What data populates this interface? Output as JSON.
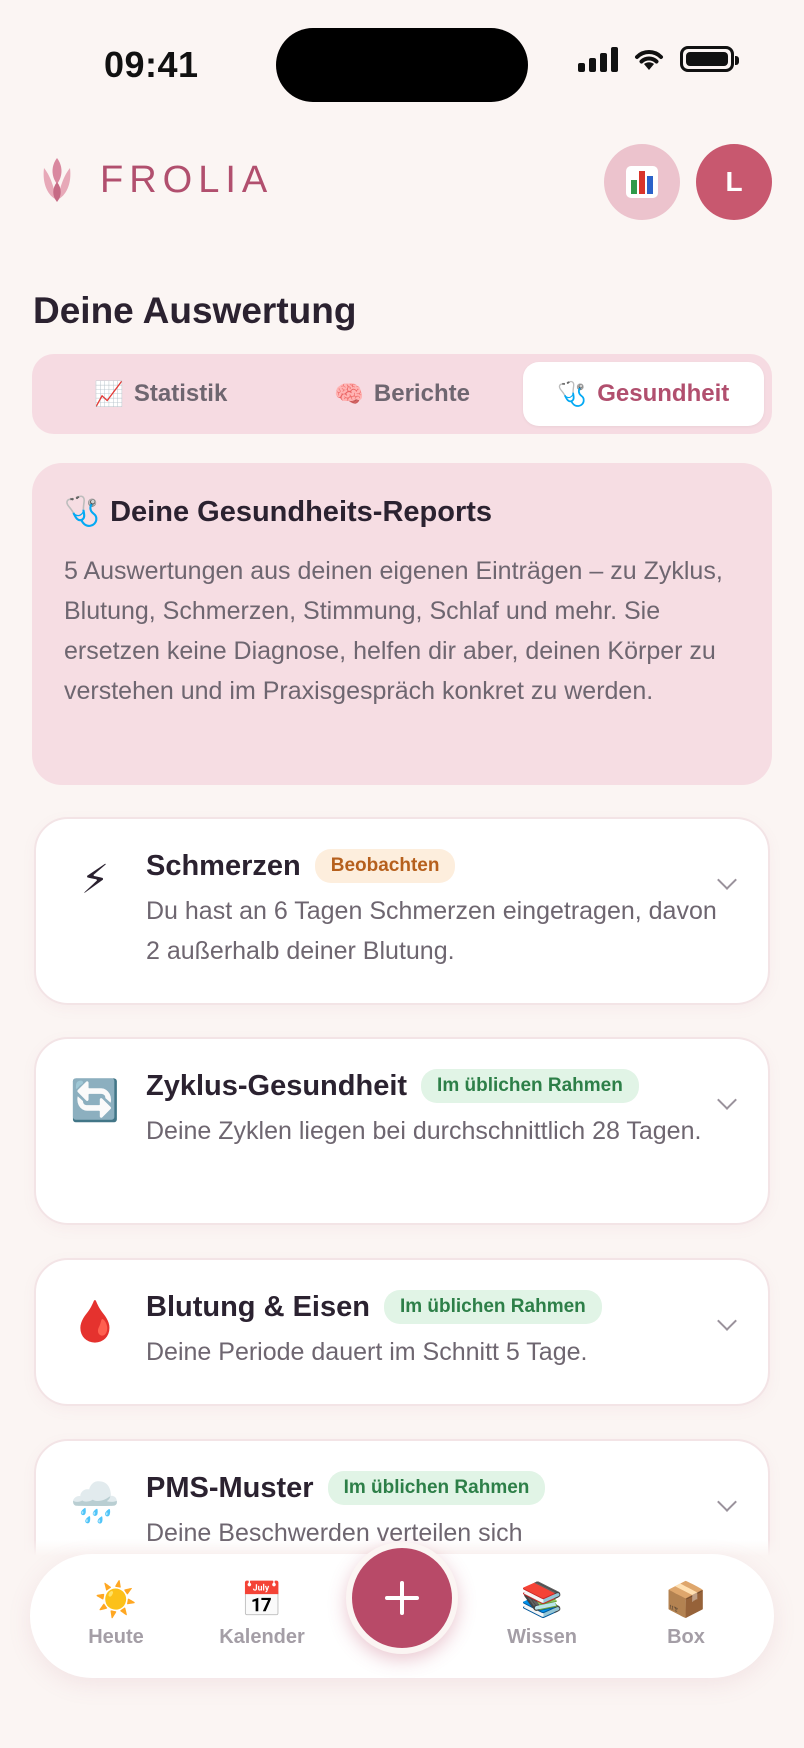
{
  "status_bar": {
    "time": "09:41"
  },
  "header": {
    "logo_text": "FROLIA",
    "avatar_initial": "L",
    "chart_button_icon": "bar-chart-icon"
  },
  "page": {
    "title": "Deine Auswertung"
  },
  "tabs": [
    {
      "emoji": "📈",
      "label": "Statistik",
      "active": false
    },
    {
      "emoji": "🧠",
      "label": "Berichte",
      "active": false
    },
    {
      "emoji": "🩺",
      "label": "Gesundheit",
      "active": true
    }
  ],
  "intro": {
    "emoji": "🩺",
    "title": "Deine Gesundheits-Reports",
    "text": "5 Auswertungen aus deinen eigenen Einträgen – zu Zyklus, Blutung, Schmerzen, Stimmung, Schlaf und mehr. Sie ersetzen keine Diagnose, helfen dir aber, deinen Körper zu verstehen und im Praxisgespräch konkret zu werden."
  },
  "reports": [
    {
      "emoji": "⚡",
      "title": "Schmerzen",
      "badge": "Beobachten",
      "badge_type": "warn",
      "text": "Du hast an 6 Tagen Schmerzen eingetragen, davon 2 außerhalb deiner Blutung."
    },
    {
      "emoji": "🔄",
      "title": "Zyklus-Gesundheit",
      "badge": "Im üblichen Rahmen",
      "badge_type": "ok",
      "text": "Deine Zyklen liegen bei durchschnittlich 28 Tagen."
    },
    {
      "emoji": "🩸",
      "title": "Blutung & Eisen",
      "badge": "Im üblichen Rahmen",
      "badge_type": "ok",
      "text": "Deine Periode dauert im Schnitt 5 Tage."
    },
    {
      "emoji": "🌧️",
      "title": "PMS-Muster",
      "badge": "Im üblichen Rahmen",
      "badge_type": "ok",
      "text": "Deine Beschwerden verteilen sich"
    }
  ],
  "bottom_nav": [
    {
      "emoji": "☀️",
      "label": "Heute"
    },
    {
      "emoji": "📅",
      "label": "Kalender"
    },
    {
      "emoji": "📚",
      "label": "Wissen"
    },
    {
      "emoji": "📦",
      "label": "Box"
    }
  ],
  "colors": {
    "background": "#fbf5f3",
    "accent": "#b84a68",
    "tab_bg": "#f6dbe2",
    "badge_warn": "#b6601d",
    "badge_ok": "#2d7f48"
  }
}
